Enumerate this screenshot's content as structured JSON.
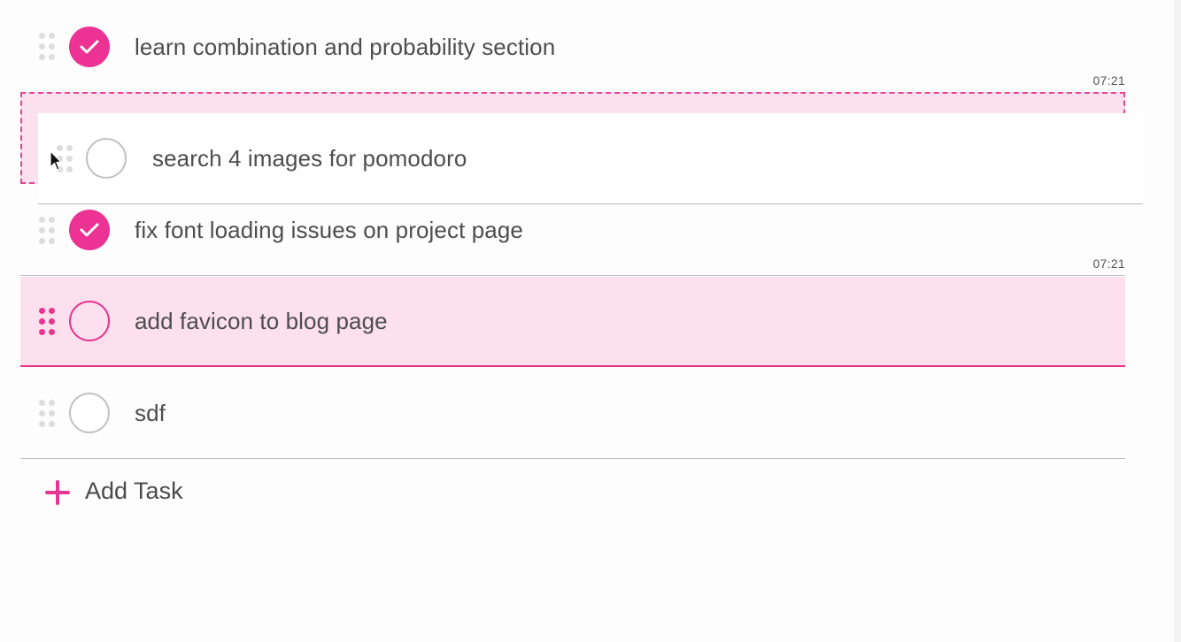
{
  "tasks": [
    {
      "label": "learn combination and probability section",
      "completed": true,
      "time": "07:21"
    },
    {
      "label": "search 4 images for pomodoro",
      "completed": false,
      "time": ""
    },
    {
      "label": "fix font loading issues on project page",
      "completed": true,
      "time": "07:21"
    },
    {
      "label": "add favicon to blog page",
      "completed": false,
      "time": ""
    },
    {
      "label": "sdf",
      "completed": false,
      "time": ""
    }
  ],
  "add_task": {
    "label": "Add Task"
  },
  "colors": {
    "accent": "#ec3393",
    "highlight_bg": "#fde0ed",
    "divider": "#bdbdbd",
    "text": "#4d4d4d"
  },
  "icons": {
    "drag": "drag-handle-icon",
    "check": "checkmark-icon",
    "add": "plus-icon",
    "cursor": "mouse-pointer-icon"
  }
}
